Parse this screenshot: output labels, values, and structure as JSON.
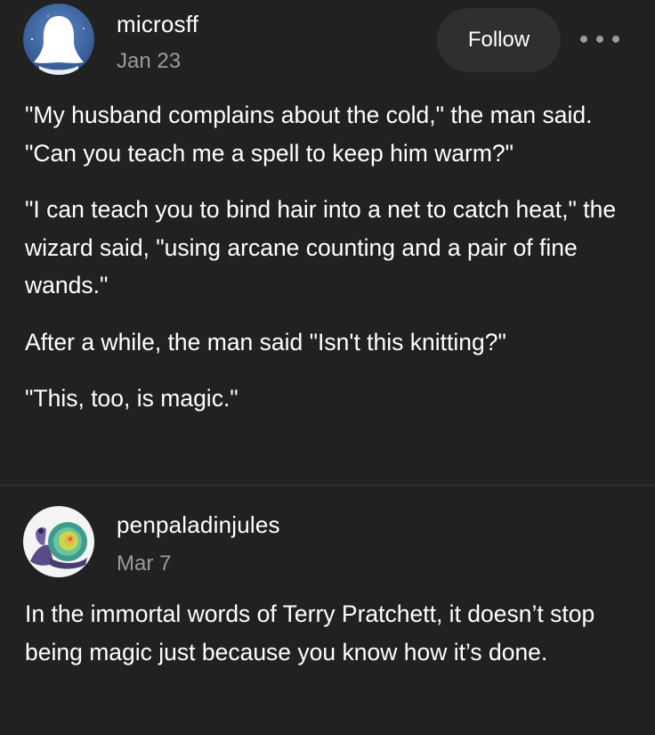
{
  "posts": [
    {
      "username": "microsff",
      "date": "Jan 23",
      "follow_label": "Follow",
      "avatar_icon": "ghost-avatar-icon",
      "more_icon": "more-options-icon",
      "paragraphs": [
        "\"My husband complains about the cold,\" the man said. \"Can you teach me a spell to keep him warm?\"",
        "\"I can teach you to bind hair into a net to catch heat,\" the wizard said, \"using arcane counting and a pair of fine wands.\"",
        "After a while, the man said \"Isn't this knitting?\"",
        "\"This, too, is magic.\""
      ]
    },
    {
      "username": "penpaladinjules",
      "date": "Mar 7",
      "avatar_icon": "snail-avatar-icon",
      "paragraphs": [
        "In the immortal words of Terry Pratchett, it doesn’t stop being magic just because you know how it’s done."
      ]
    }
  ],
  "colors": {
    "background": "#212121",
    "text": "#ffffff",
    "muted": "#9b9b9b",
    "button": "#2f2f2f",
    "divider": "#3a3a3a"
  }
}
